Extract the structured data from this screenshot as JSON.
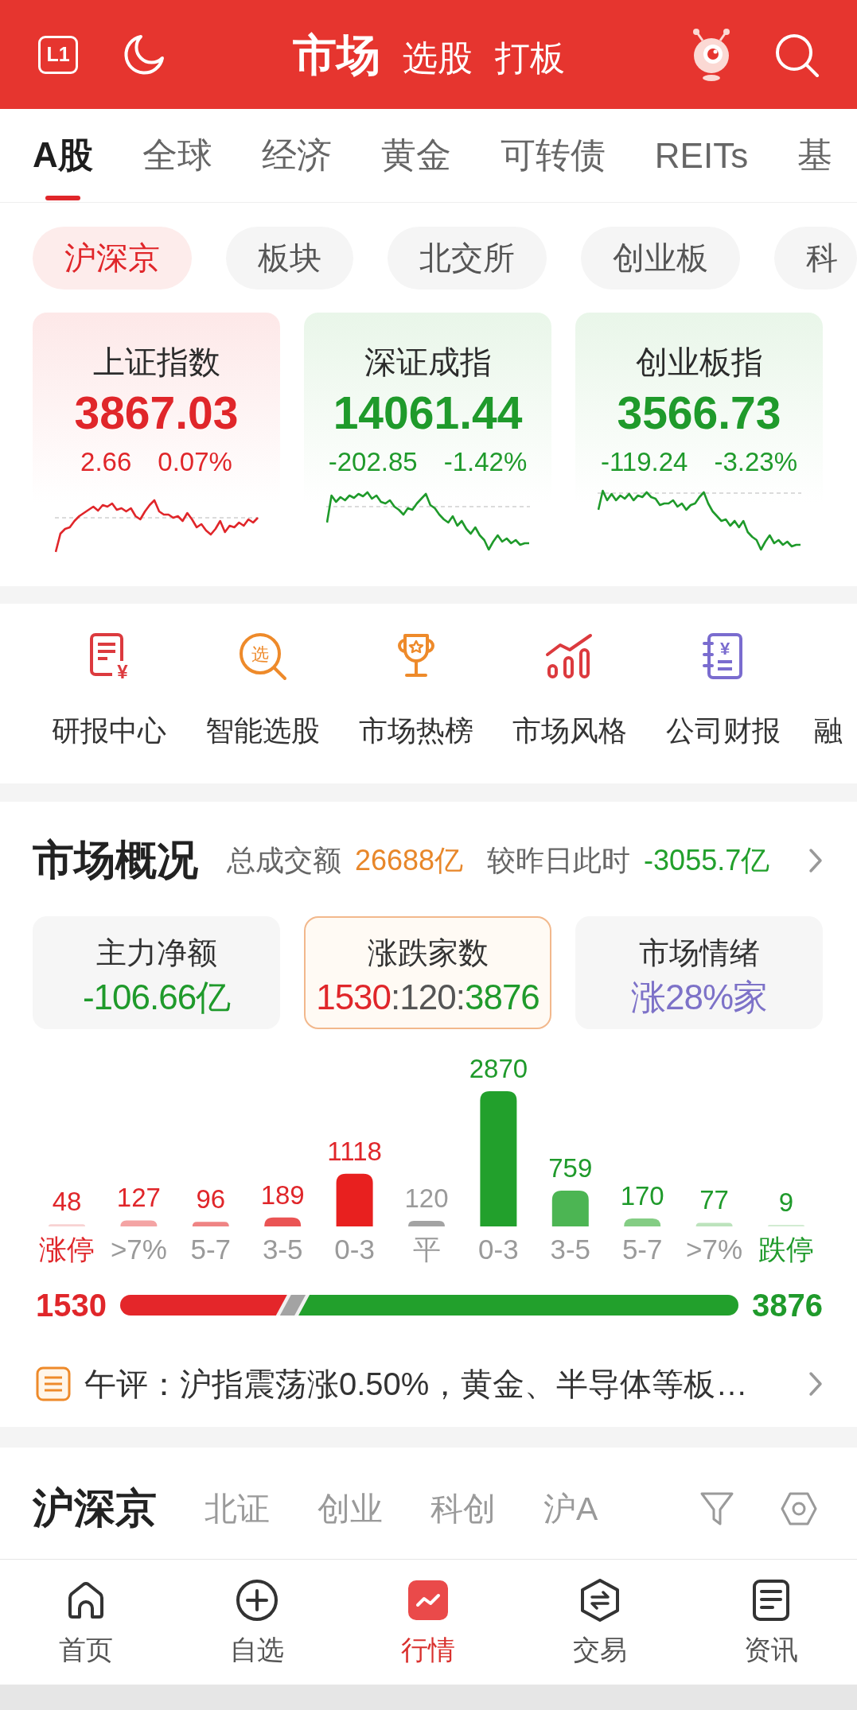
{
  "header": {
    "badge": "L1",
    "tabs": [
      {
        "label": "市场",
        "selected": true
      },
      {
        "label": "选股",
        "selected": false
      },
      {
        "label": "打板",
        "selected": false
      }
    ]
  },
  "market_tabs": [
    {
      "label": "A股",
      "selected": true
    },
    {
      "label": "全球",
      "selected": false
    },
    {
      "label": "经济",
      "selected": false
    },
    {
      "label": "黄金",
      "selected": false
    },
    {
      "label": "可转债",
      "selected": false
    },
    {
      "label": "REITs",
      "selected": false
    },
    {
      "label": "基",
      "selected": false
    }
  ],
  "exchange_chips": [
    {
      "label": "沪深京",
      "selected": true
    },
    {
      "label": "板块",
      "selected": false
    },
    {
      "label": "北交所",
      "selected": false
    },
    {
      "label": "创业板",
      "selected": false
    },
    {
      "label": "科",
      "selected": false
    }
  ],
  "index_cards": [
    {
      "name": "上证指数",
      "value": "3867.03",
      "change": "2.66",
      "change_pct": "0.07%",
      "kind": "up"
    },
    {
      "name": "深证成指",
      "value": "14061.44",
      "change": "-202.85",
      "change_pct": "-1.42%",
      "kind": "down"
    },
    {
      "name": "创业板指",
      "value": "3566.73",
      "change": "-119.24",
      "change_pct": "-3.23%",
      "kind": "down"
    }
  ],
  "quick_links": [
    {
      "label": "研报中心",
      "glyph": "¥"
    },
    {
      "label": "智能选股",
      "glyph": "选"
    },
    {
      "label": "市场热榜"
    },
    {
      "label": "市场风格"
    },
    {
      "label": "公司财报",
      "glyph": "¥"
    },
    {
      "label": "融"
    }
  ],
  "market_overview": {
    "title": "市场概况",
    "summary": [
      {
        "label": "总成交额",
        "value": "26688亿",
        "color": "#e8872a"
      },
      {
        "label": "较昨日此时",
        "value": "-3055.7亿",
        "color": "#22a02c"
      }
    ],
    "stat_cards": [
      {
        "label": "主力净额",
        "value_parts": [
          {
            "text": "-106.66亿",
            "color": "#1f9a2b"
          }
        ],
        "selected": false
      },
      {
        "label": "涨跌家数",
        "value_parts": [
          {
            "text": "1530",
            "color": "#e0262a"
          },
          {
            "text": ":120:",
            "color": "#555555"
          },
          {
            "text": "3876",
            "color": "#1f9a2b"
          }
        ],
        "selected": true
      },
      {
        "label": "市场情绪",
        "value_parts": [
          {
            "text": "涨28%家",
            "color": "#7d72c8"
          }
        ],
        "selected": false
      }
    ],
    "chart_data": {
      "type": "bar",
      "categories": [
        "涨停",
        ">7%",
        "5-7",
        "3-5",
        "0-3",
        "平",
        "0-3",
        "3-5",
        "5-7",
        ">7%",
        "跌停"
      ],
      "series": [
        {
          "color": "#f8d2d2",
          "values": [
            48,
            null,
            null,
            null,
            null,
            null,
            null,
            null,
            null,
            null,
            null
          ]
        },
        {
          "color": "#f4a4a4",
          "values": [
            null,
            127,
            null,
            null,
            null,
            null,
            null,
            null,
            null,
            null,
            null
          ]
        },
        {
          "color": "#ef8484",
          "values": [
            null,
            null,
            96,
            null,
            null,
            null,
            null,
            null,
            null,
            null,
            null
          ]
        },
        {
          "color": "#ea5454",
          "values": [
            null,
            null,
            null,
            189,
            null,
            null,
            null,
            null,
            null,
            null,
            null
          ]
        },
        {
          "color": "#e8201f",
          "values": [
            null,
            null,
            null,
            null,
            1118,
            null,
            null,
            null,
            null,
            null,
            null
          ]
        },
        {
          "color": "#a3a3a3",
          "values": [
            null,
            null,
            null,
            null,
            null,
            120,
            null,
            null,
            null,
            null,
            null
          ]
        },
        {
          "color": "#22a02c",
          "values": [
            null,
            null,
            null,
            null,
            null,
            null,
            2870,
            null,
            null,
            null,
            null
          ]
        },
        {
          "color": "#4cb553",
          "values": [
            null,
            null,
            null,
            null,
            null,
            null,
            null,
            759,
            null,
            null,
            null
          ]
        },
        {
          "color": "#84cd84",
          "values": [
            null,
            null,
            null,
            null,
            null,
            null,
            null,
            null,
            170,
            null,
            null
          ]
        },
        {
          "color": "#bce3bc",
          "values": [
            null,
            null,
            null,
            null,
            null,
            null,
            null,
            null,
            null,
            77,
            null
          ]
        },
        {
          "color": "#d2ecd2",
          "values": [
            null,
            null,
            null,
            null,
            null,
            null,
            null,
            null,
            null,
            null,
            9
          ]
        }
      ],
      "stacked": true,
      "data_labels": true
    },
    "ratio_bar": {
      "up_count": "1530",
      "down_count": "3876",
      "segments": [
        {
          "kind": "up",
          "level": 0.27
        },
        {
          "kind": "flat",
          "level": 0.03
        },
        {
          "kind": "down",
          "level": 0.7
        }
      ]
    },
    "commentary": "午评：沪指震荡涨0.50%，黄金、半导体等板…"
  },
  "list_tabs": [
    {
      "label": "沪深京",
      "selected": true
    },
    {
      "label": "北证",
      "selected": false
    },
    {
      "label": "创业",
      "selected": false
    },
    {
      "label": "科创",
      "selected": false
    },
    {
      "label": "沪A",
      "selected": false
    }
  ],
  "bottom_nav": [
    {
      "label": "首页",
      "selected": false
    },
    {
      "label": "自选",
      "selected": false
    },
    {
      "label": "行情",
      "selected": true
    },
    {
      "label": "交易",
      "selected": false
    },
    {
      "label": "资讯",
      "selected": false
    }
  ]
}
